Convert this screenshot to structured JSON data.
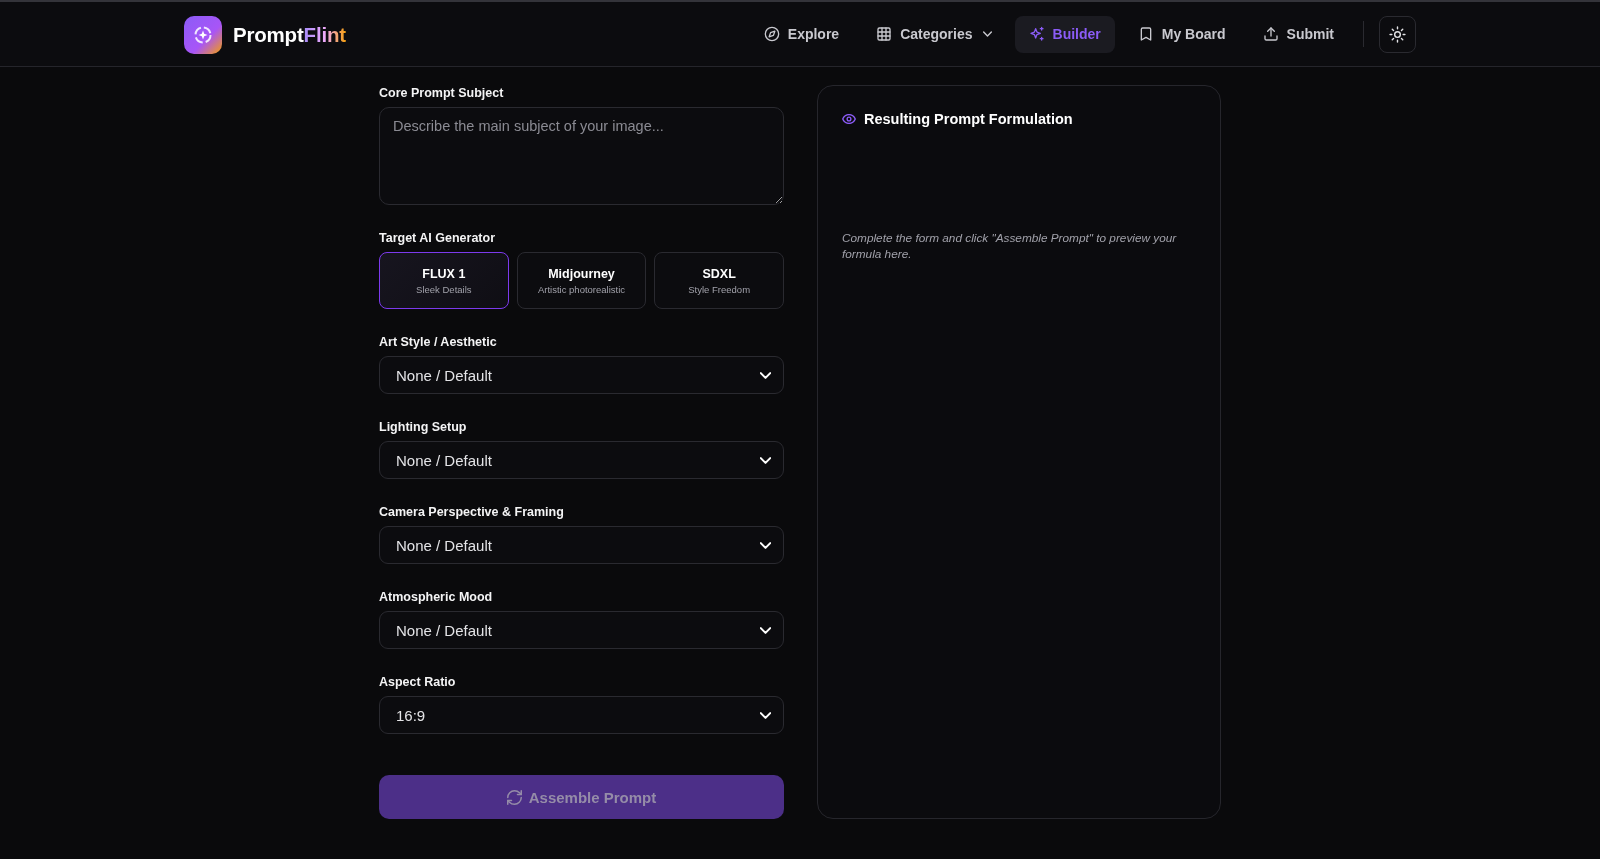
{
  "header": {
    "brand": {
      "name": "Prompt",
      "accent": "Flint"
    },
    "nav": [
      {
        "label": "Explore",
        "selected": false,
        "dropdown": false
      },
      {
        "label": "Categories",
        "selected": false,
        "dropdown": true
      },
      {
        "label": "Builder",
        "selected": true,
        "dropdown": false
      },
      {
        "label": "My Board",
        "selected": false,
        "dropdown": false
      },
      {
        "label": "Submit",
        "selected": false,
        "dropdown": false
      }
    ]
  },
  "form": {
    "subject": {
      "label": "Core Prompt Subject",
      "placeholder": "Describe the main subject of your image..."
    },
    "generator": {
      "label": "Target AI Generator",
      "options": [
        {
          "name": "FLUX 1",
          "description": "Sleek Details",
          "selected": true
        },
        {
          "name": "Midjourney",
          "description": "Artistic photorealistic",
          "selected": false
        },
        {
          "name": "SDXL",
          "description": "Style Freedom",
          "selected": false
        }
      ]
    },
    "selects": [
      {
        "label": "Art Style / Aesthetic",
        "value": "None / Default"
      },
      {
        "label": "Lighting Setup",
        "value": "None / Default"
      },
      {
        "label": "Camera Perspective & Framing",
        "value": "None / Default"
      },
      {
        "label": "Atmospheric Mood",
        "value": "None / Default"
      },
      {
        "label": "Aspect Ratio",
        "value": "16:9"
      }
    ],
    "submit": {
      "label": "Assemble Prompt",
      "disabled": true
    }
  },
  "preview": {
    "title": "Resulting Prompt Formulation",
    "hint": "Complete the form and click \"Assemble Prompt\" to preview your formula here."
  }
}
